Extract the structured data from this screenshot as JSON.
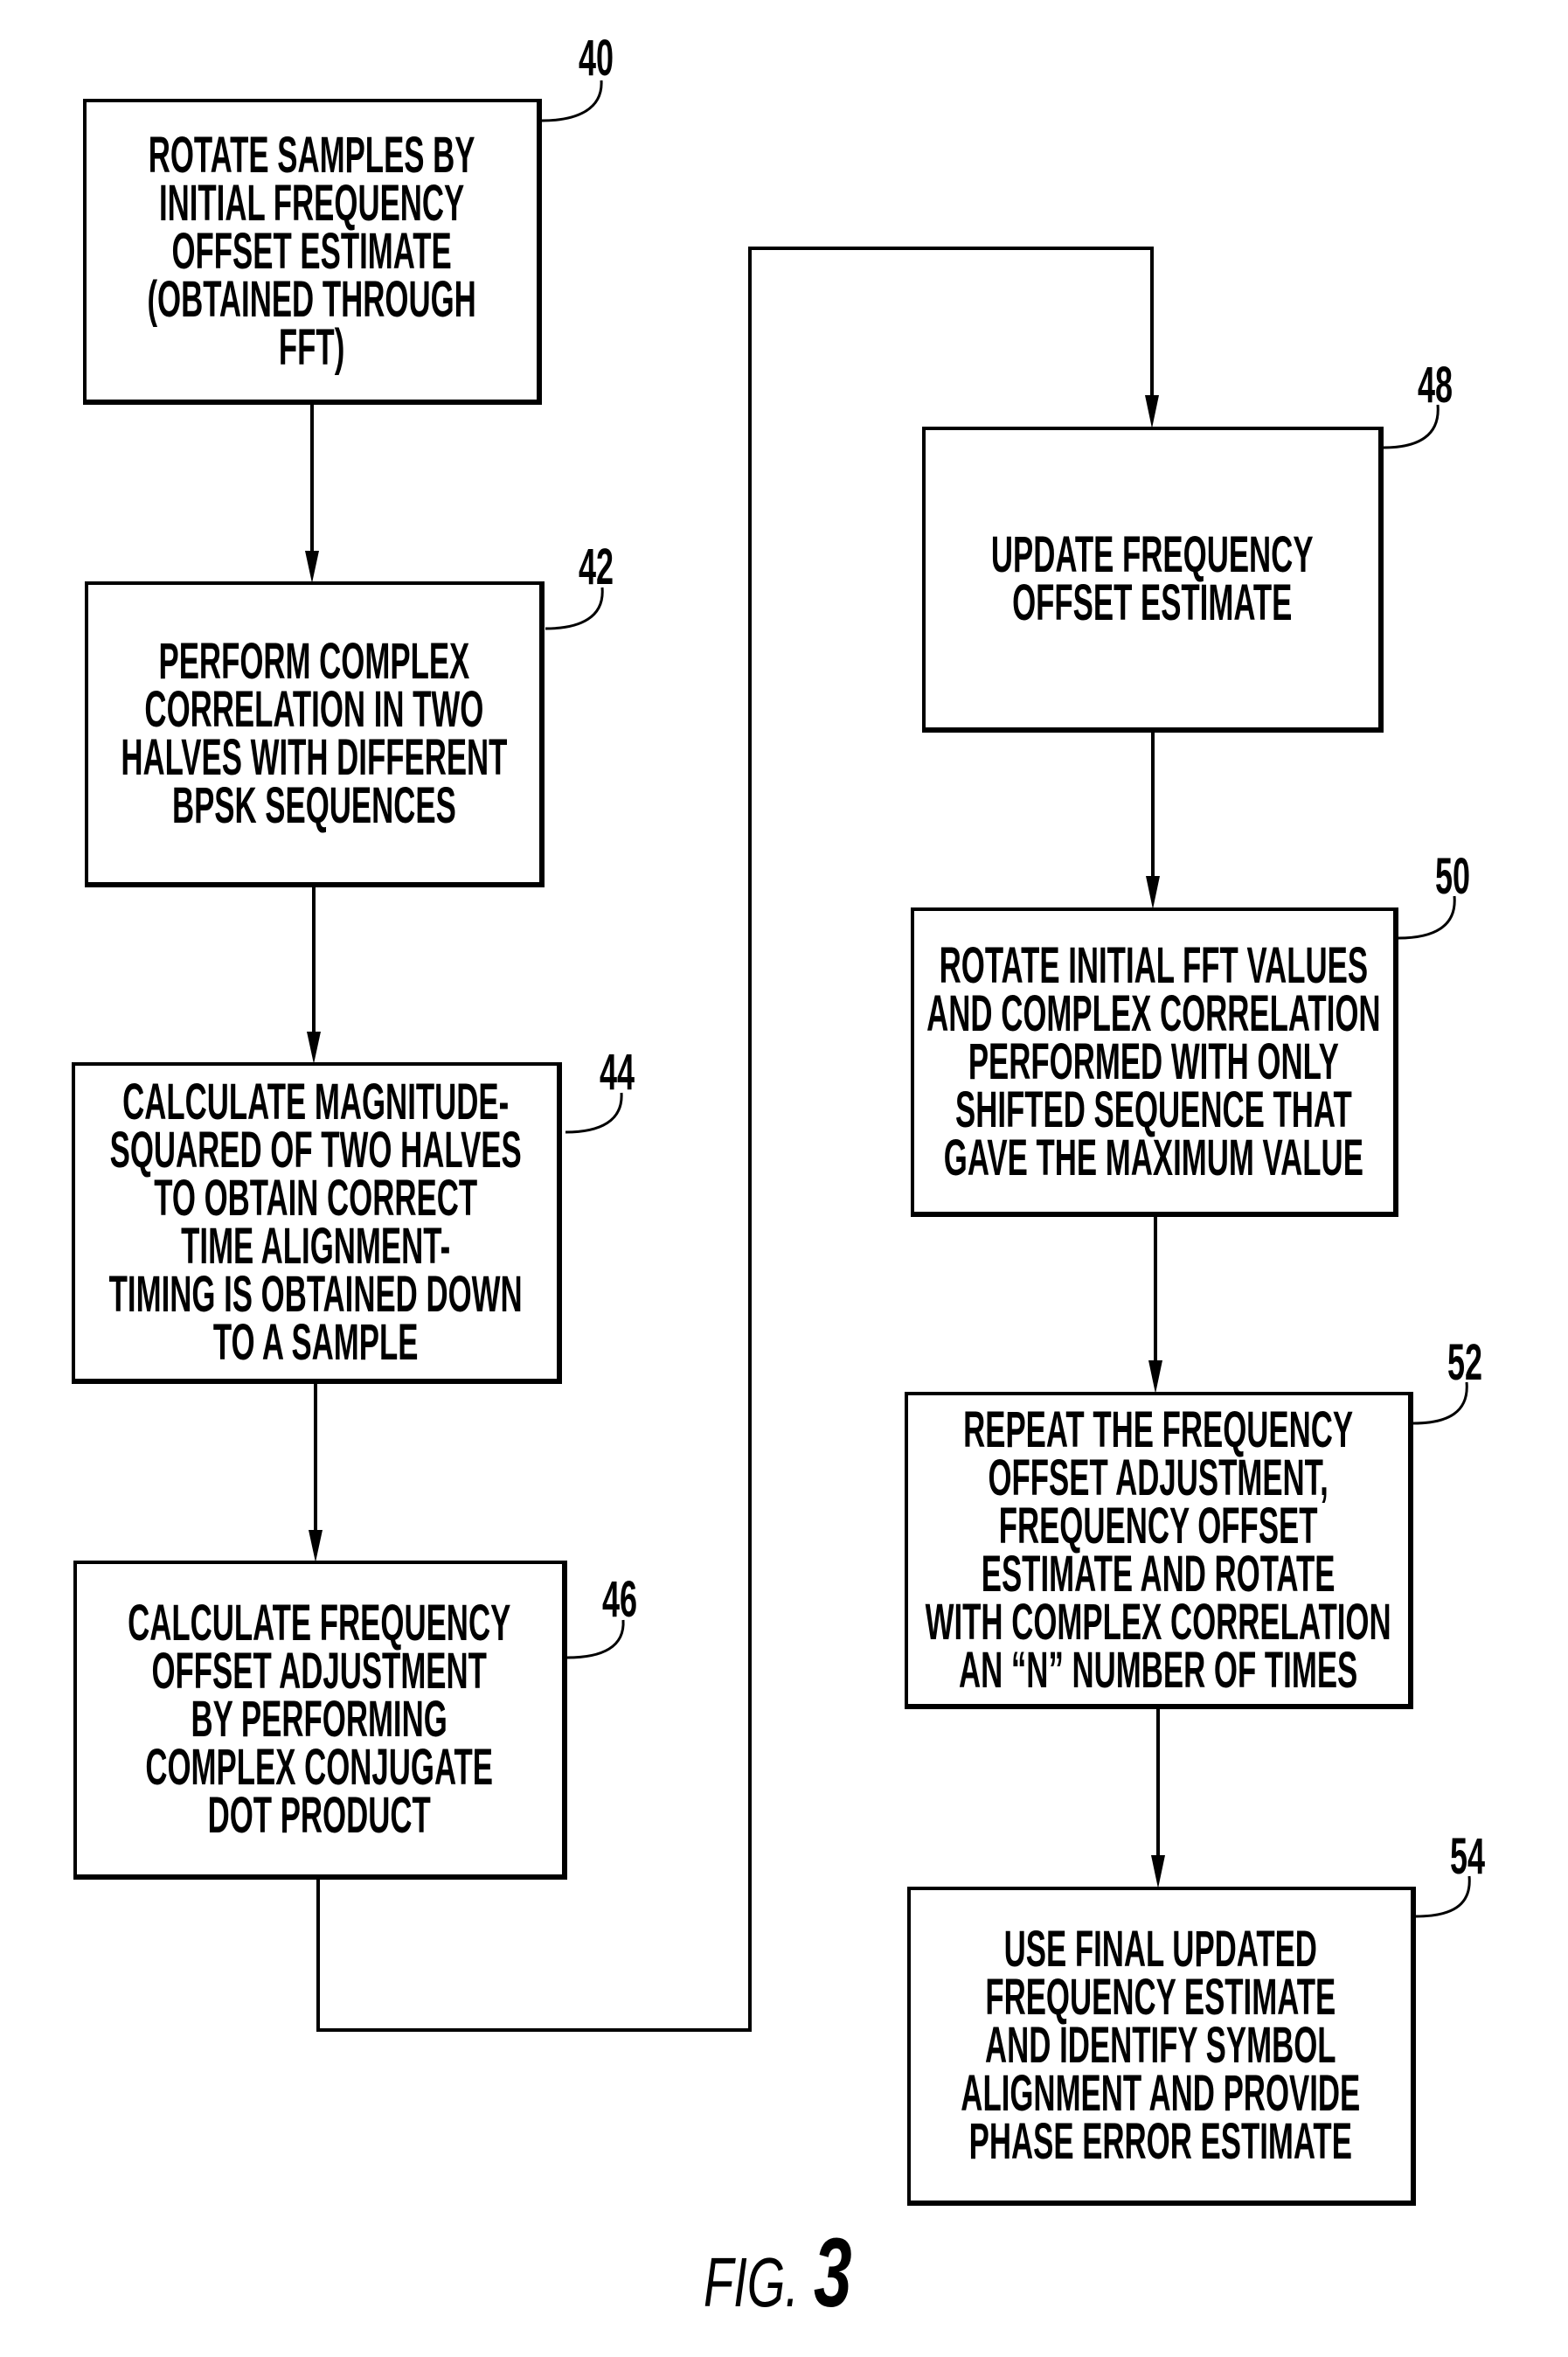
{
  "figure": {
    "caption_word": "FIG.",
    "caption_number": "3"
  },
  "steps": [
    {
      "ref": "40",
      "text": "ROTATE SAMPLES BY\nINITIAL FREQUENCY\nOFFSET ESTIMATE\n(OBTAINED THROUGH\nFFT)"
    },
    {
      "ref": "42",
      "text": "PERFORM COMPLEX\nCORRELATION IN TWO\nHALVES WITH DIFFERENT\nBPSK SEQUENCES"
    },
    {
      "ref": "44",
      "text": "CALCULATE MAGNITUDE-\nSQUARED OF TWO HALVES\nTO OBTAIN CORRECT\nTIME ALIGNMENT-\nTIMING IS OBTAINED DOWN\nTO A SAMPLE"
    },
    {
      "ref": "46",
      "text": "CALCULATE FREQUENCY\nOFFSET ADJUSTMENT\nBY PERFORMING\nCOMPLEX CONJUGATE\nDOT PRODUCT"
    },
    {
      "ref": "48",
      "text": "UPDATE FREQUENCY\nOFFSET ESTIMATE"
    },
    {
      "ref": "50",
      "text": "ROTATE INITIAL FFT VALUES\nAND COMPLEX CORRELATION\nPERFORMED WITH ONLY\nSHIFTED SEQUENCE THAT\nGAVE THE MAXIMUM VALUE"
    },
    {
      "ref": "52",
      "text": "REPEAT THE FREQUENCY\nOFFSET ADJUSTMENT,\nFREQUENCY OFFSET\nESTIMATE AND ROTATE\nWITH COMPLEX CORRELATION\nAN “N” NUMBER OF TIMES"
    },
    {
      "ref": "54",
      "text": "USE FINAL UPDATED\nFREQUENCY ESTIMATE\nAND IDENTIFY SYMBOL\nALIGNMENT AND PROVIDE\nPHASE ERROR ESTIMATE"
    }
  ],
  "flow": [
    {
      "from": "40",
      "to": "42"
    },
    {
      "from": "42",
      "to": "44"
    },
    {
      "from": "44",
      "to": "46"
    },
    {
      "from": "46",
      "to": "48"
    },
    {
      "from": "48",
      "to": "50"
    },
    {
      "from": "50",
      "to": "52"
    },
    {
      "from": "52",
      "to": "54"
    }
  ]
}
